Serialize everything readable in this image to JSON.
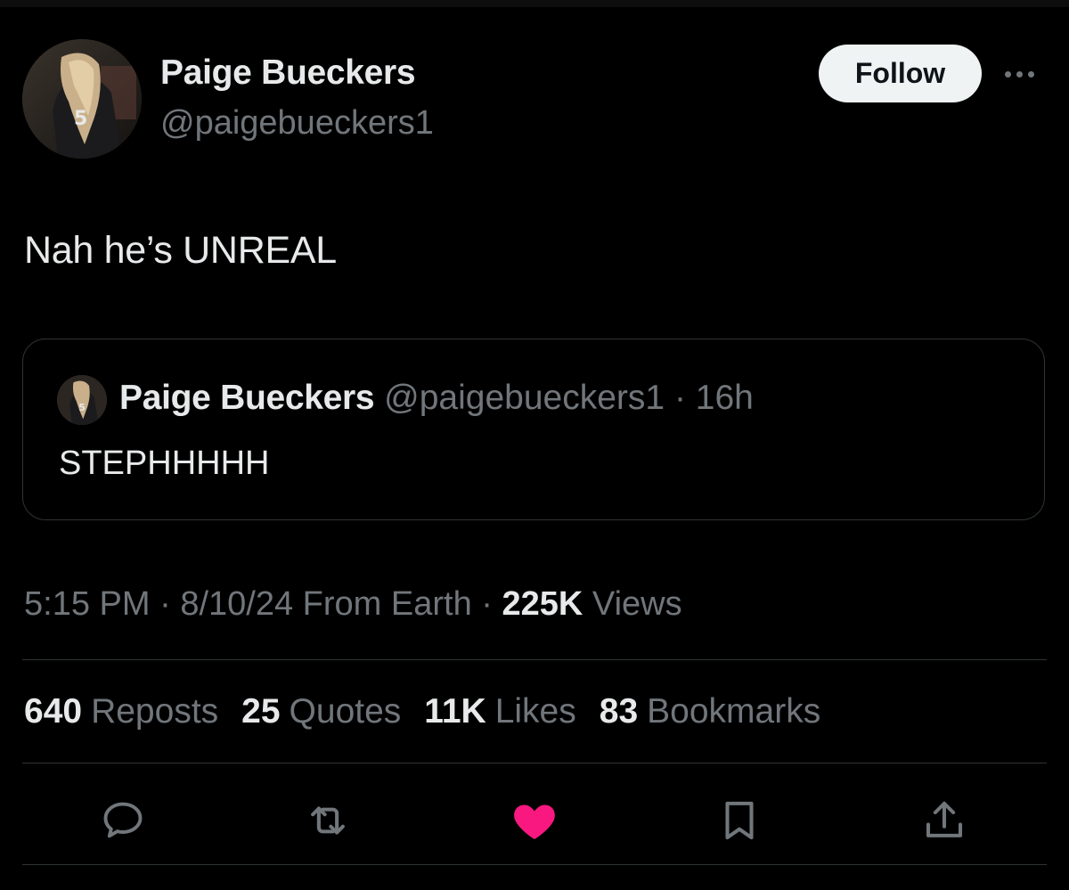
{
  "author": {
    "name": "Paige Bueckers",
    "handle": "@paigebueckers1",
    "avatar_jersey": "5"
  },
  "header": {
    "follow_label": "Follow",
    "more_icon": "more-horizontal-icon"
  },
  "tweet": {
    "text": "Nah he’s UNREAL"
  },
  "quote": {
    "name": "Paige Bueckers",
    "handle": "@paigebueckers1",
    "separator": " · ",
    "time": "16h",
    "text": "STEPHHHHH"
  },
  "meta": {
    "time": "5:15 PM",
    "date": "8/10/24",
    "source": "From Earth",
    "views_count": "225K",
    "views_label": "Views"
  },
  "stats": [
    {
      "count": "640",
      "label": "Reposts"
    },
    {
      "count": "25",
      "label": "Quotes"
    },
    {
      "count": "11K",
      "label": "Likes"
    },
    {
      "count": "83",
      "label": "Bookmarks"
    }
  ],
  "actions": [
    {
      "icon": "reply-icon"
    },
    {
      "icon": "repost-icon"
    },
    {
      "icon": "like-icon",
      "liked": true
    },
    {
      "icon": "bookmark-icon"
    },
    {
      "icon": "share-icon"
    }
  ],
  "colors": {
    "background": "#000000",
    "text_primary": "#e7e9ea",
    "text_secondary": "#71767b",
    "border": "#2f3336",
    "like": "#f91880",
    "follow_bg": "#eff3f4"
  }
}
